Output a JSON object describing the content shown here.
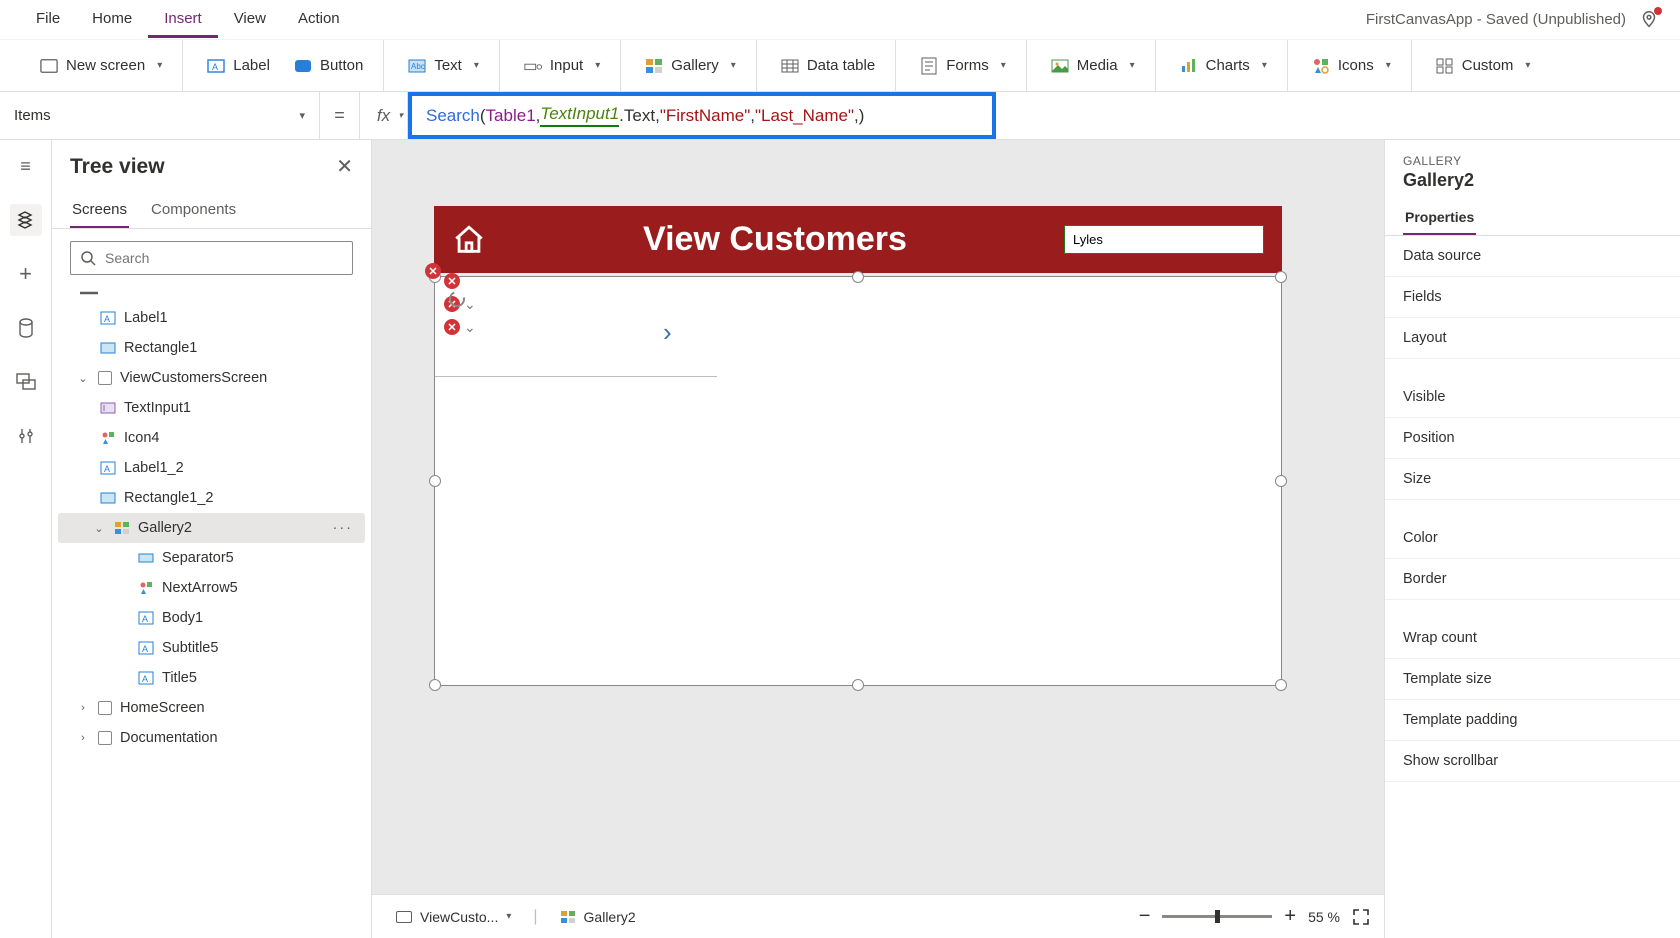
{
  "menu": {
    "file": "File",
    "home": "Home",
    "insert": "Insert",
    "view": "View",
    "action": "Action"
  },
  "app_title": "FirstCanvasApp - Saved (Unpublished)",
  "ribbon": {
    "new_screen": "New screen",
    "label": "Label",
    "button": "Button",
    "text": "Text",
    "input": "Input",
    "gallery": "Gallery",
    "data_table": "Data table",
    "forms": "Forms",
    "media": "Media",
    "charts": "Charts",
    "icons": "Icons",
    "custom": "Custom"
  },
  "formula": {
    "property": "Items",
    "eq": "=",
    "fx": "fx",
    "fn": "Search",
    "open": "(",
    "id1": "Table1",
    "comma": ", ",
    "id2": "TextInput1",
    "dot_text": ".Text",
    "str1": "\"FirstName\"",
    "str2": "\"Last_Name\"",
    "trail": ", ",
    "close": ")"
  },
  "tree": {
    "title": "Tree view",
    "tab_screens": "Screens",
    "tab_components": "Components",
    "search_placeholder": "Search",
    "items": {
      "label1": "Label1",
      "rect1": "Rectangle1",
      "vcs": "ViewCustomersScreen",
      "textinput1": "TextInput1",
      "icon4": "Icon4",
      "label1_2": "Label1_2",
      "rect1_2": "Rectangle1_2",
      "gallery2": "Gallery2",
      "sep5": "Separator5",
      "next5": "NextArrow5",
      "body1": "Body1",
      "subtitle5": "Subtitle5",
      "title5": "Title5",
      "homescreen": "HomeScreen",
      "documentation": "Documentation"
    }
  },
  "canvas": {
    "header_title": "View Customers",
    "search_value": "Lyles"
  },
  "footer": {
    "crumb1": "ViewCusto...",
    "crumb2": "Gallery2",
    "zoom_value": "55",
    "zoom_suffix": "%"
  },
  "props": {
    "type": "GALLERY",
    "name": "Gallery2",
    "tab_properties": "Properties",
    "rows": {
      "data_source": "Data source",
      "fields": "Fields",
      "layout": "Layout",
      "visible": "Visible",
      "position": "Position",
      "size": "Size",
      "color": "Color",
      "border": "Border",
      "wrap_count": "Wrap count",
      "template_size": "Template size",
      "template_pad": "Template padding",
      "show_scroll": "Show scrollbar"
    }
  }
}
